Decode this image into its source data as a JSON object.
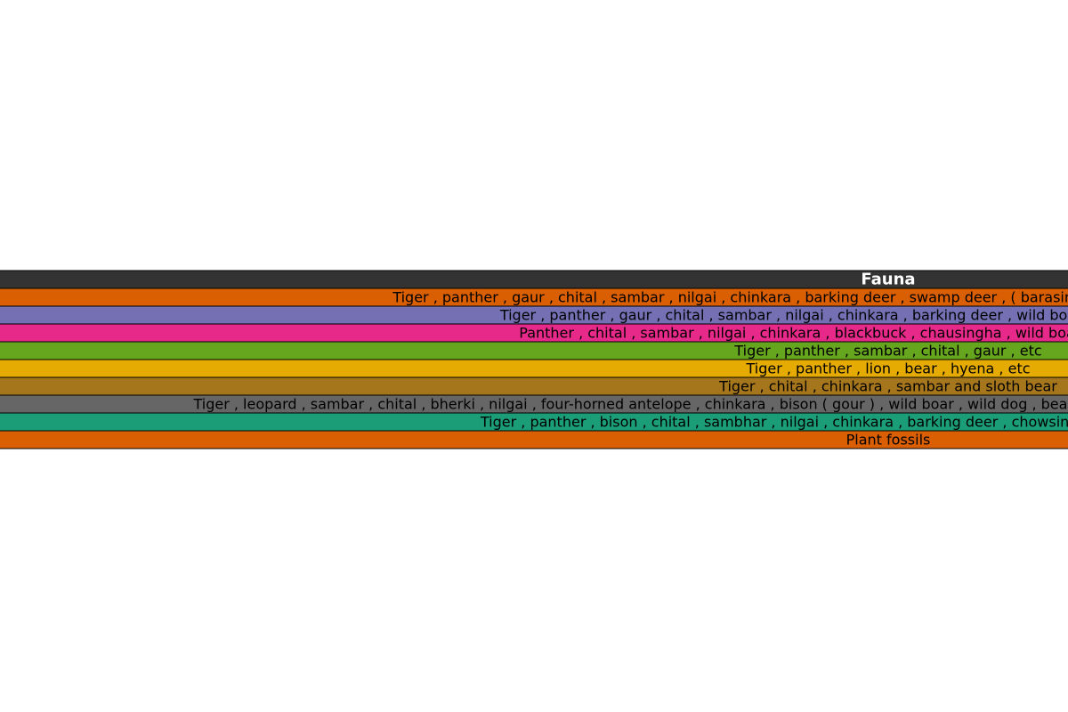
{
  "chart_data": {
    "type": "table",
    "columns": [
      "Fauna"
    ],
    "header_color": "#333333",
    "rows": [
      {
        "cells": [
          "Tiger , panther , gaur , chital , sambar , nilgai , chinkara , barking deer , swamp deer , ( barasingha ) , wild boar , sloth bear , wild dog , etc"
        ],
        "color": "#d95f02"
      },
      {
        "cells": [
          "Tiger , panther , gaur , chital , sambar , nilgai , chinkara , barking deer , wild boar , sloth bear , wild dog , etc"
        ],
        "color": "#7570b3"
      },
      {
        "cells": [
          "Panther , chital , sambar , nilgai , chinkara , blackbuck , chausingha , wild boar , crocodile , gharial , etc"
        ],
        "color": "#e7298a"
      },
      {
        "cells": [
          "Tiger , panther , sambar , chital , gaur , etc"
        ],
        "color": "#66a61e"
      },
      {
        "cells": [
          "Tiger , panther , lion , bear , hyena , etc"
        ],
        "color": "#e6ab02"
      },
      {
        "cells": [
          "Tiger , chital , chinkara , sambar and sloth bear"
        ],
        "color": "#a6761d"
      },
      {
        "cells": [
          "Tiger , leopard , sambar , chital , bherki , nilgai , four-horned antelope , chinkara , bison ( gour ) , wild boar , wild dog , bear , black buck , jackal , fox , porcupine , flying squirrel , mouse deer , etc"
        ],
        "color": "#666666"
      },
      {
        "cells": [
          "Tiger , panther , bison , chital , sambhar , nilgai , chinkara , barking deer , chowsingha , wild boar , sloth bear , etc"
        ],
        "color": "#1b9e77"
      },
      {
        "cells": [
          "Plant fossils"
        ],
        "color": "#d95f02"
      }
    ]
  }
}
